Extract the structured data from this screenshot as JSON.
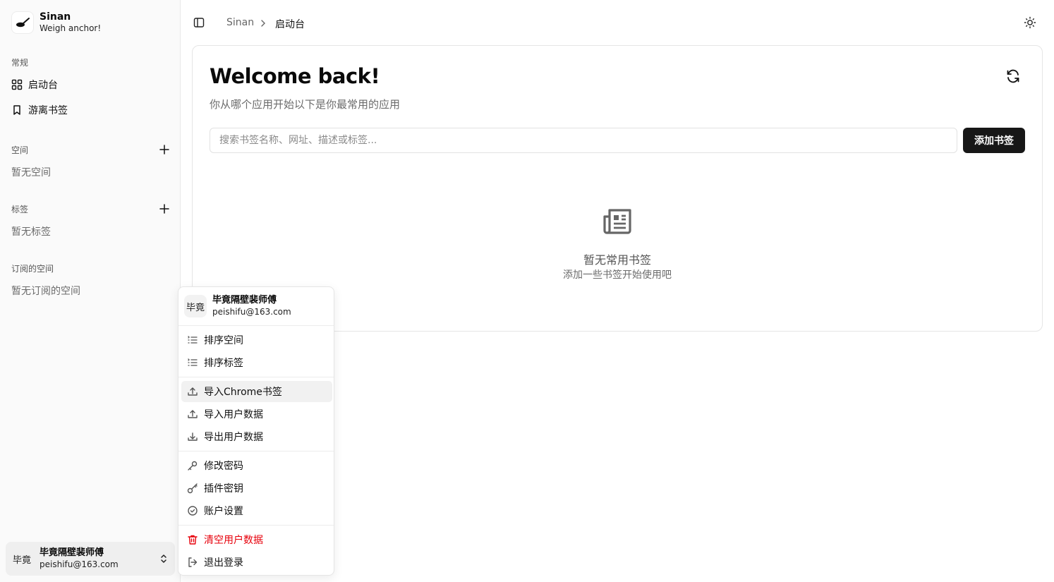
{
  "brand": {
    "name": "Sinan",
    "tagline": "Weigh anchor!"
  },
  "sidebar": {
    "general_label": "常规",
    "nav": [
      {
        "label": "启动台",
        "icon": "grid-icon"
      },
      {
        "label": "游离书签",
        "icon": "bookmark-icon"
      }
    ],
    "spaces": {
      "label": "空间",
      "empty": "暂无空间"
    },
    "tags": {
      "label": "标签",
      "empty": "暂无标签"
    },
    "subscribed": {
      "label": "订阅的空间",
      "empty": "暂无订阅的空间"
    }
  },
  "user": {
    "avatar_text": "毕竟",
    "name": "毕竟隔壁裴师傅",
    "email": "peishifu@163.com"
  },
  "header": {
    "breadcrumb": [
      "Sinan",
      "启动台"
    ]
  },
  "main": {
    "title": "Welcome back!",
    "subtitle": "你从哪个应用开始以下是你最常用的应用",
    "search_placeholder": "搜索书签名称、网址、描述或标签...",
    "search_value": "",
    "add_button": "添加书签",
    "empty_title": "暂无常用书签",
    "empty_subtitle": "添加一些书签开始使用吧"
  },
  "menu": {
    "items": [
      {
        "label": "排序空间",
        "icon": "sort-list-icon"
      },
      {
        "label": "排序标签",
        "icon": "sort-list-icon"
      },
      {
        "label": "导入Chrome书签",
        "icon": "upload-icon"
      },
      {
        "label": "导入用户数据",
        "icon": "upload-icon"
      },
      {
        "label": "导出用户数据",
        "icon": "download-icon"
      },
      {
        "label": "修改密码",
        "icon": "key-icon"
      },
      {
        "label": "插件密钥",
        "icon": "key-round-icon"
      },
      {
        "label": "账户设置",
        "icon": "check-circle-icon"
      },
      {
        "label": "清空用户数据",
        "icon": "trash-icon"
      },
      {
        "label": "退出登录",
        "icon": "logout-icon"
      }
    ]
  },
  "colors": {
    "primary": "#171717",
    "danger": "#e7000b",
    "sidebar_bg": "#fafafa"
  }
}
